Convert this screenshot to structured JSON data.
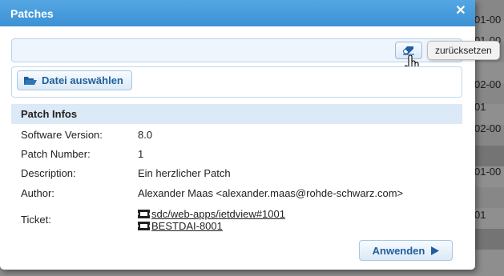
{
  "background": {
    "fragments": [
      "01-00",
      "01-00",
      "02-00",
      "01",
      "02-00",
      "01-00",
      "01"
    ]
  },
  "dialog": {
    "title": "Patches",
    "close_icon": "close-icon",
    "reset_tooltip": "zurücksetzen",
    "select_file_label": "Datei auswählen",
    "section_title": "Patch Infos",
    "fields": {
      "software_version_label": "Software Version:",
      "software_version_value": "8.0",
      "patch_number_label": "Patch Number:",
      "patch_number_value": "1",
      "description_label": "Description:",
      "description_value": "Ein herzlicher Patch",
      "author_label": "Author:",
      "author_value": "Alexander Maas <alexander.maas@rohde-schwarz.com>",
      "ticket_label": "Ticket:",
      "ticket_links": [
        "sdc/web-apps/ietdview#1001",
        "BESTDAI-8001"
      ]
    },
    "apply_label": "Anwenden"
  },
  "colors": {
    "titlebar": "#3c91d4",
    "accent_text": "#1f5f9c",
    "section_header_bg": "#dce9f6"
  }
}
